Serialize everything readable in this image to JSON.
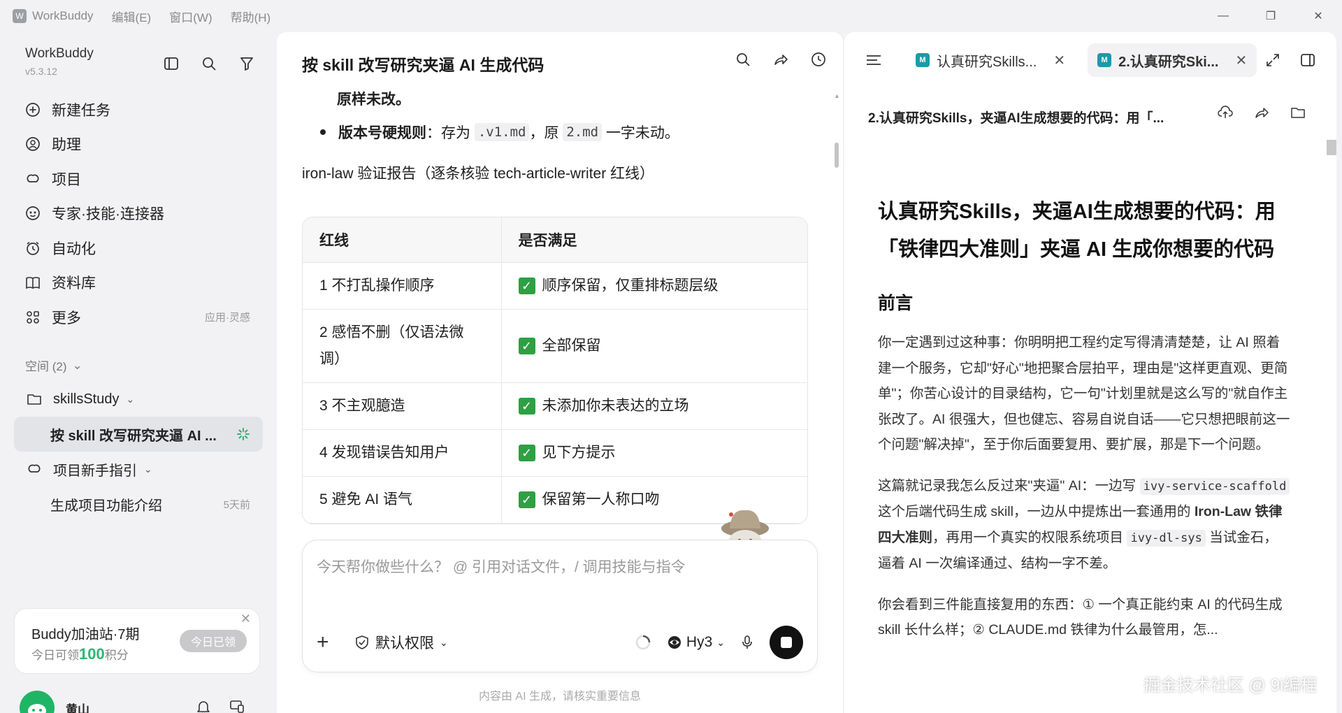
{
  "titlebar": {
    "app_name": "WorkBuddy",
    "menus": [
      "编辑(E)",
      "窗口(W)",
      "帮助(H)"
    ]
  },
  "sidebar": {
    "brand": "WorkBuddy",
    "version": "v5.3.12",
    "nav": [
      {
        "label": "新建任务",
        "icon": "plus-circle-icon"
      },
      {
        "label": "助理",
        "icon": "assistant-icon"
      },
      {
        "label": "项目",
        "icon": "project-icon"
      },
      {
        "label": "专家·技能·连接器",
        "icon": "expert-icon"
      },
      {
        "label": "自动化",
        "icon": "alarm-clock-icon"
      },
      {
        "label": "资料库",
        "icon": "book-icon"
      },
      {
        "label": "更多",
        "icon": "grid-icon",
        "extra": "应用·灵感"
      }
    ],
    "space_header": "空间 (2)",
    "tree": {
      "folder": "skillsStudy",
      "active_task": "按 skill 改写研究夹逼 AI ...",
      "guide": "项目新手指引",
      "guide_child": "生成项目功能介绍",
      "guide_child_time": "5天前"
    },
    "promo": {
      "title": "Buddy加油站·7期",
      "sub_prefix": "今日可领",
      "sub_points": "100",
      "sub_suffix": "积分",
      "button": "今日已领"
    },
    "user": {
      "name": "黄山"
    }
  },
  "main": {
    "title": "按 skill 改写研究夹逼 AI 生成代码",
    "line_bold": "原样未改。",
    "bullet_label": "版本号硬规则",
    "bullet_text_1": "：存为",
    "bullet_code_1": ".v1.md",
    "bullet_text_2": "，原",
    "bullet_code_2": "2.md",
    "bullet_text_3": "一字未动。",
    "heading": "iron-law 验证报告（逐条核验 tech-article-writer 红线）",
    "table": {
      "headers": [
        "红线",
        "是否满足"
      ],
      "rows": [
        [
          "1 不打乱操作顺序",
          "顺序保留，仅重排标题层级"
        ],
        [
          "2 感悟不删（仅语法微调）",
          "全部保留"
        ],
        [
          "3 不主观臆造",
          "未添加你未表达的立场"
        ],
        [
          "4 发现错误告知用户",
          "见下方提示"
        ],
        [
          "5 避免 AI 语气",
          "保留第一人称口吻"
        ]
      ]
    },
    "composer": {
      "placeholder": "今天帮你做些什么？  @ 引用对话文件，/ 调用技能与指令",
      "permission": "默认权限",
      "model": "Hy3"
    },
    "disclaimer": "内容由 AI 生成，请核实重要信息"
  },
  "doc": {
    "tabs": [
      {
        "label": "认真研究Skills..."
      },
      {
        "label": "2.认真研究Ski..."
      }
    ],
    "crumb": "2.认真研究Skills，夹逼AI生成想要的代码：用「...",
    "h1": "认真研究Skills，夹逼AI生成想要的代码：用「铁律四大准则」夹逼 AI 生成你想要的代码",
    "h2": "前言",
    "p1": "你一定遇到过这种事：你明明把工程约定写得清清楚楚，让 AI 照着建一个服务，它却\"好心\"地把聚合层拍平，理由是\"这样更直观、更简单\"；你苦心设计的目录结构，它一句\"计划里就是这么写的\"就自作主张改了。AI 很强大，但也健忘、容易自说自话——它只想把眼前这一个问题\"解决掉\"，至于你后面要复用、要扩展，那是下一个问题。",
    "p2_a": "这篇就记录我怎么反过来\"夹逼\" AI：一边写",
    "p2_code1": "ivy-service-scaffold",
    "p2_b": "这个后端代码生成 skill，一边从中提炼出一套通用的",
    "p2_bold": "Iron-Law 铁律四大准则",
    "p2_c": "，再用一个真实的权限系统项目",
    "p2_code2": "ivy-dl-sys",
    "p2_d": "当试金石，逼着 AI 一次编译通过、结构一字不差。",
    "p3": "你会看到三件能直接复用的东西：① 一个真正能约束 AI 的代码生成 skill 长什么样；② CLAUDE.md 铁律为什么最管用，怎...",
    "watermark": "掘金技术社区 @ 9i编程"
  }
}
